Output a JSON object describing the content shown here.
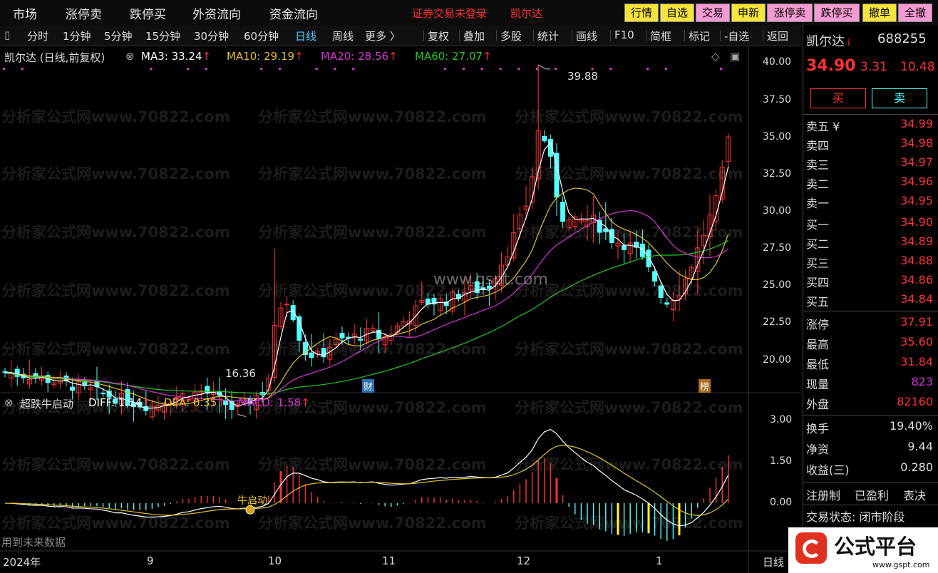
{
  "menu": {
    "items": [
      "市场",
      "涨停卖",
      "跌停买",
      "外资流向",
      "资金流向"
    ],
    "status": "证券交易未登录",
    "stock": "凯尔达",
    "buttons": [
      {
        "label": "行情",
        "bg": "#f6e43a"
      },
      {
        "label": "自选",
        "bg": "#f6e43a"
      },
      {
        "label": "交易",
        "bg": "#f59ad2"
      },
      {
        "label": "申新",
        "bg": "#f6e43a"
      },
      {
        "label": "涨停卖",
        "bg": "#f59ad2"
      },
      {
        "label": "跌停买",
        "bg": "#f59ad2"
      },
      {
        "label": "撤单",
        "bg": "#f6e43a"
      },
      {
        "label": "全撤",
        "bg": "#f59ad2"
      }
    ]
  },
  "toolbar": {
    "periods": [
      "分时",
      "1分钟",
      "5分钟",
      "15分钟",
      "30分钟",
      "60分钟",
      "日线",
      "周线",
      "更多 〉"
    ],
    "active": "日线",
    "tools": [
      "复权",
      "叠加",
      "多股",
      "统计",
      "画线",
      "F10",
      "简框",
      "标记",
      "-自选",
      "返回"
    ]
  },
  "chart_legend": {
    "title": "凯尔达 (日线,前复权)",
    "ma3": "MA3: 33.24",
    "ma10": "MA10: 29.19",
    "ma20": "MA20: 28.56",
    "ma60": "MA60: 27.07"
  },
  "indicator_legend": {
    "title": "超跌牛启动",
    "diff": "DIFF: 1.14",
    "dea": "DEA: 0.35",
    "macd": "MACD: 1.58",
    "signal": "牛启动",
    "note": "用到未来数据"
  },
  "markers": {
    "high": "39.88",
    "low": "16.36",
    "cai": "财",
    "bang": "榜"
  },
  "time_axis": {
    "labels": [
      "2024年",
      "9",
      "10",
      "11",
      "12",
      "1"
    ],
    "period": "日线"
  },
  "watermark": {
    "text": "分析家公式网www.70822.com",
    "center": "www.gspt.com"
  },
  "logo": {
    "text": "公式平台",
    "url": "www.gspt.com"
  },
  "colors": {
    "up": "#ff3232",
    "down": "#54ffff",
    "ma3": "#ffffff",
    "ma10": "#e5c22a",
    "ma20": "#d534d5",
    "ma60": "#22c822"
  },
  "chart_data": {
    "type": "candlestick",
    "price_axis": {
      "ylim": [
        16,
        40.5
      ],
      "ticks": [
        "40.00",
        "37.50",
        "35.00",
        "32.50",
        "30.00",
        "27.50",
        "25.00",
        "22.50",
        "20.00"
      ]
    },
    "macd_axis": {
      "ylim": [
        -1.4,
        3.4
      ],
      "ticks": [
        "3.00",
        "1.50",
        "0.00"
      ]
    },
    "annotations": {
      "high": 39.88,
      "low": 16.36
    },
    "ma_final": {
      "MA3": 33.24,
      "MA10": 29.19,
      "MA20": 28.56,
      "MA60": 27.07
    },
    "macd_final": {
      "DIFF": 1.14,
      "DEA": 0.35,
      "MACD": 1.58
    }
  },
  "quote": {
    "name": "凯尔达",
    "code": "688255",
    "price": "34.90",
    "change": "3.31",
    "pct": "10.48",
    "buy": "买",
    "sell": "卖",
    "asks": [
      {
        "label": "卖五 ¥",
        "price": "34.99"
      },
      {
        "label": "卖四",
        "price": "34.98"
      },
      {
        "label": "卖三",
        "price": "34.97"
      },
      {
        "label": "卖二",
        "price": "34.96"
      },
      {
        "label": "卖一",
        "price": "34.95"
      }
    ],
    "bids": [
      {
        "label": "买一",
        "price": "34.90"
      },
      {
        "label": "买二",
        "price": "34.89"
      },
      {
        "label": "买三",
        "price": "34.88"
      },
      {
        "label": "买四",
        "price": "34.86"
      },
      {
        "label": "买五",
        "price": "34.84"
      }
    ],
    "stats": [
      {
        "label": "涨停",
        "value": "37.91",
        "color": "#ff3232"
      },
      {
        "label": "最高",
        "value": "35.60",
        "color": "#ff3232"
      },
      {
        "label": "最低",
        "value": "31.84",
        "color": "#ff3232"
      },
      {
        "label": "现量",
        "value": "823",
        "color": "#d534d5"
      },
      {
        "label": "外盘",
        "value": "82160",
        "color": "#ff3232"
      }
    ],
    "stats2": [
      {
        "label": "换手",
        "value": "19.40%"
      },
      {
        "label": "净资",
        "value": "9.44"
      },
      {
        "label": "收益(三)",
        "value": "0.280"
      }
    ],
    "reg": [
      "注册制",
      "已盈利",
      "表决"
    ],
    "trade_state": "交易状态: 闭市阶段"
  }
}
